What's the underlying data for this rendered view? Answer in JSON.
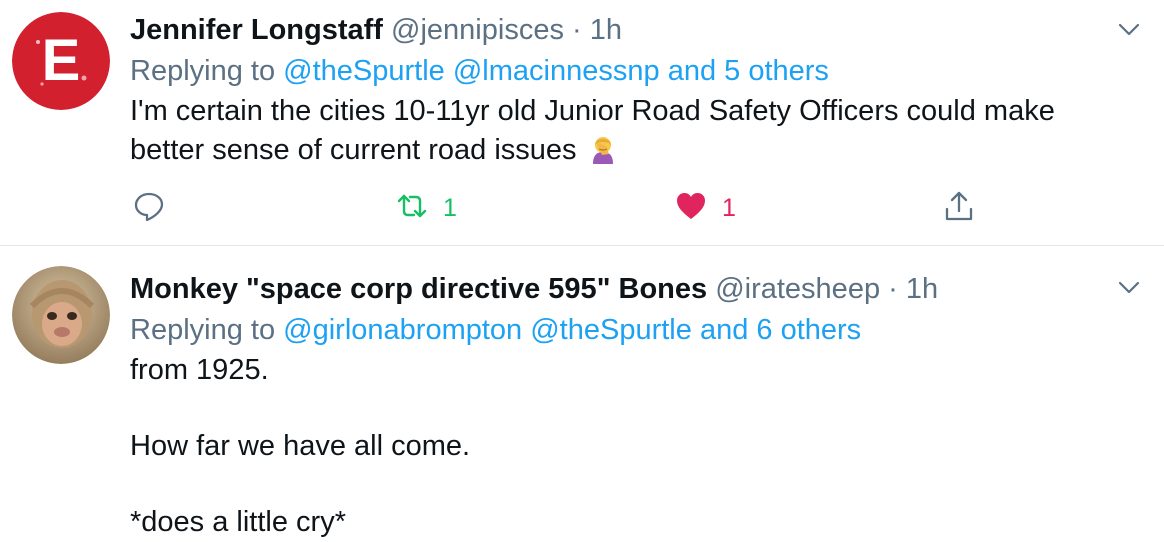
{
  "tweets": [
    {
      "author_name": "Jennifer Longstaff",
      "handle": "@jennipisces",
      "separator": "·",
      "time": "1h",
      "replying_prefix": "Replying to",
      "replying_mentions": [
        "@theSpurtle",
        "@lmacinnessnp",
        "and 5 others"
      ],
      "text_line1": "I'm certain the cities 10-11yr old Junior Road Safety Officers could make",
      "text_line2": "better sense of current road issues",
      "emoji": "person-facepalming-emoji",
      "retweet_count": "1",
      "like_count": "1",
      "avatar": "letter-e-logo",
      "avatar_letter": "E",
      "colors": {
        "avatar_bg": "#d2202f",
        "retweet": "#17bf63",
        "like": "#e0245e"
      }
    },
    {
      "author_name": "Monkey \"space corp directive 595\" Bones",
      "handle": "@iratesheep",
      "separator": "·",
      "time": "1h",
      "replying_prefix": "Replying to",
      "replying_mentions": [
        "@girlonabrompton",
        "@theSpurtle",
        "and 6 others"
      ],
      "paragraphs": [
        "from 1925.",
        "How far we have all come.",
        "*does a little cry*"
      ],
      "avatar": "monkey-photo"
    }
  ],
  "colors": {
    "link": "#1da1f2",
    "muted": "#5b7083",
    "text": "#0f1419",
    "divider": "#e1e8ed"
  }
}
